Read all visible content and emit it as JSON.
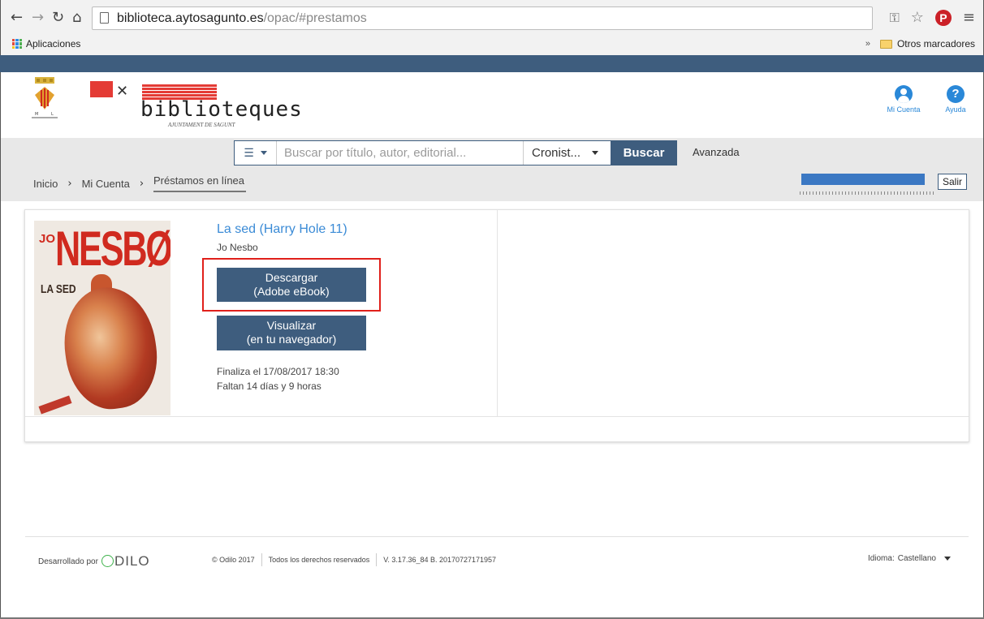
{
  "browser": {
    "url_host": "biblioteca.aytosagunto.es",
    "url_path": "/opac/#prestamos",
    "bookmarks": {
      "apps_label": "Aplicaciones",
      "chevron": "»",
      "other_label": "Otros marcadores"
    }
  },
  "header": {
    "logo_word": "biblioteques",
    "logo_sub": "AJUNTAMENT DE SAGUNT",
    "user_menu_label": "Mi Cuenta",
    "help_label": "Ayuda"
  },
  "search": {
    "placeholder": "Buscar por título, autor, editorial...",
    "scope_value": "Cronist...",
    "button_label": "Buscar",
    "advanced_label": "Avanzada"
  },
  "breadcrumb": {
    "items": [
      "Inicio",
      "Mi Cuenta",
      "Préstamos en línea"
    ],
    "separator": "›"
  },
  "session": {
    "logout_label": "Salir"
  },
  "loan": {
    "cover_author_a": "JO",
    "cover_author_b": "NESBØ",
    "cover_title": "LA SED",
    "title": "La sed (Harry Hole 11)",
    "author": "Jo Nesbo",
    "download_line1": "Descargar",
    "download_line2": "(Adobe eBook)",
    "view_line1": "Visualizar",
    "view_line2": "(en tu navegador)",
    "due_line": "Finaliza el 17/08/2017 18:30",
    "remaining_line": "Faltan 14 días y 9 horas"
  },
  "footer": {
    "developed_by": "Desarrollado por",
    "brand": "DILO",
    "copyright": "© Odilo 2017",
    "rights": "Todos los derechos reservados",
    "version": "V. 3.17.36_84 B. 20170727171957",
    "language_label": "Idioma:",
    "language_value": "Castellano"
  },
  "colors": {
    "brand_blue": "#3e5d7e",
    "link_blue": "#3b8bd6",
    "highlight_red": "#e0201b",
    "logo_red": "#e43b35"
  },
  "icons": [
    "back-icon",
    "forward-icon",
    "reload-icon",
    "home-icon",
    "page-icon",
    "key-icon",
    "star-icon",
    "pinterest-icon",
    "menu-icon",
    "apps-icon",
    "folder-icon",
    "crest-icon",
    "user-icon",
    "help-icon",
    "list-icon"
  ]
}
